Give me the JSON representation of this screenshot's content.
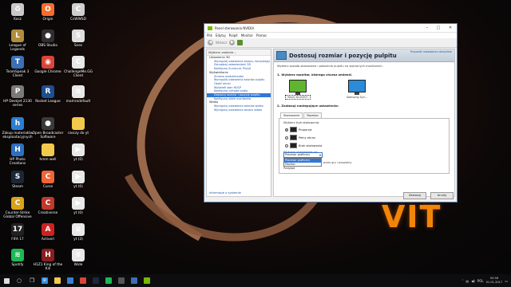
{
  "desktop": {
    "wallpaper_text": "VIT",
    "icons": [
      {
        "label": "Kosz",
        "icon": "recycle-bin-icon",
        "color": "#c9c9c9",
        "glyph": "♻"
      },
      {
        "label": "League of Legends",
        "icon": "league-of-legends-icon",
        "color": "#b08d3c",
        "glyph": "L"
      },
      {
        "label": "TeamSpeak 3 Client",
        "icon": "teamspeak-icon",
        "color": "#3d6fb5",
        "glyph": "T"
      },
      {
        "label": "HP Deskjet 2130 series",
        "icon": "printer-icon",
        "color": "#7a7a7a",
        "glyph": "P"
      },
      {
        "label": "Zakup materiałów eksploatacyjnych",
        "icon": "hp-icon",
        "color": "#2a7fd1",
        "glyph": "h"
      },
      {
        "label": "HP Photo Creations",
        "icon": "hp-photo-icon",
        "color": "#2f6fc1",
        "glyph": "H"
      },
      {
        "label": "Steam",
        "icon": "steam-icon",
        "color": "#1b2838",
        "glyph": "S"
      },
      {
        "label": "Counter-Strike Global Offensive",
        "icon": "csgo-icon",
        "color": "#d8a21a",
        "glyph": "C"
      },
      {
        "label": "FIFA 17",
        "icon": "fifa-icon",
        "color": "#222222",
        "glyph": "17"
      },
      {
        "label": "Spotify",
        "icon": "spotify-icon",
        "color": "#1db954",
        "glyph": "≋"
      },
      {
        "label": "Origin",
        "icon": "origin-icon",
        "color": "#f56c2d",
        "glyph": "O"
      },
      {
        "label": "OBS Studio",
        "icon": "obs-icon",
        "color": "#302e31",
        "glyph": "●"
      },
      {
        "label": "Google Chrome",
        "icon": "chrome-icon",
        "color": "#db4437",
        "glyph": "◉"
      },
      {
        "label": "Rocket League",
        "icon": "rocket-league-icon",
        "color": "#1d4f91",
        "glyph": "R"
      },
      {
        "label": "Open Broadcaster Software",
        "icon": "obs-classic-icon",
        "color": "#3a3a3a",
        "glyph": "●"
      },
      {
        "label": "hmm well",
        "icon": "folder-icon",
        "color": "#f2c94c",
        "glyph": ""
      },
      {
        "label": "Curse",
        "icon": "curse-icon",
        "color": "#f16436",
        "glyph": "C"
      },
      {
        "label": "Creativerse",
        "icon": "creativerse-icon",
        "color": "#c0392b",
        "glyph": "C"
      },
      {
        "label": "Activeri",
        "icon": "activeri-icon",
        "color": "#cc2222",
        "glyph": "A"
      },
      {
        "label": "H1Z1 King of the Kill",
        "icon": "h1z1-icon",
        "color": "#8a1f1f",
        "glyph": "H"
      },
      {
        "label": "CsWWSD",
        "icon": "app-icon",
        "color": "#cfcfcf",
        "glyph": "C"
      },
      {
        "label": "Snes",
        "icon": "snes-icon",
        "color": "#dddddd",
        "glyph": "S"
      },
      {
        "label": "ChallengeMe.GG Client",
        "icon": "challengeme-icon",
        "color": "#e8e8e8",
        "glyph": "C"
      },
      {
        "label": "mamrodefault",
        "icon": "file-icon",
        "color": "#e8e8e8",
        "glyph": "≡"
      },
      {
        "label": "rzeczy do yt",
        "icon": "folder-icon",
        "color": "#f2c94c",
        "glyph": ""
      },
      {
        "label": "yt (0)",
        "icon": "video-file-icon",
        "color": "#e8e8e8",
        "glyph": "▶"
      },
      {
        "label": "yt (0)",
        "icon": "video-file-icon",
        "color": "#e8e8e8",
        "glyph": "▶"
      },
      {
        "label": "yt (0)",
        "icon": "video-file-icon",
        "color": "#e8e8e8",
        "glyph": "▶"
      },
      {
        "label": "yt (3)",
        "icon": "document-icon",
        "color": "#e8e8e8",
        "glyph": "≡"
      },
      {
        "label": "Wide",
        "icon": "file-icon",
        "color": "#e8e8e8",
        "glyph": "≡"
      }
    ]
  },
  "window": {
    "title": "Panel sterowania NVIDIA",
    "menu": [
      "Plik",
      "Edytuj",
      "Pulpit",
      "Monitor",
      "Pomoc"
    ],
    "back_label": "Wstecz",
    "left_panel": {
      "header": "Wybierz zadanie...",
      "tree": [
        {
          "category": "Ustawienia 3D",
          "items": [
            {
              "label": "Wyregulój ustawienia obrazu, korzystając",
              "selected": false
            },
            {
              "label": "Zarządzaj ustawieniami 3D",
              "selected": false
            },
            {
              "label": "Konfiguruj Surround, PhysX",
              "selected": false
            }
          ]
        },
        {
          "category": "Wyświetlanie",
          "items": [
            {
              "label": "Zmiana rozdzielczości",
              "selected": false
            },
            {
              "label": "Wyregulój ustawienia kolorów pulpitu",
              "selected": false
            },
            {
              "label": "Obróć ekran",
              "selected": false
            },
            {
              "label": "Wyświetl stan HDCP",
              "selected": false
            },
            {
              "label": "Konfiguruj cyfrowe audio",
              "selected": false
            },
            {
              "label": "Dostosuj rozmiar i pozycję pulpitu",
              "selected": true
            },
            {
              "label": "Konfiguruj wiele monitorów",
              "selected": false
            }
          ]
        },
        {
          "category": "Wideo",
          "items": [
            {
              "label": "Wyreguluj ustawienia kolorów wideo",
              "selected": false
            },
            {
              "label": "Wyreguluj ustawienia obrazu wideo",
              "selected": false
            }
          ]
        }
      ],
      "system_info": "Informacje o systemie"
    },
    "content": {
      "title": "Dostosuj rozmiar i pozycję pulpitu",
      "restore_defaults": "Przywróć ustawienia domyślne",
      "subtitle": "Wybierz sposób skalowania i położenia pulpitu na wybranych monitorach.",
      "step1": "1. Wybierz monitor, którego chcesz zmienić.",
      "monitors": [
        {
          "label": "BenQ XL2430T",
          "selected": true
        },
        {
          "label": "Samsung Syn...",
          "selected": false
        }
      ],
      "step2": "2. Zastosuj następujące ustawienia:",
      "tabs": [
        "Skalowanie",
        "Rozmiar"
      ],
      "mode_label": "Wybierz tryb skalowania:",
      "modes": [
        {
          "label": "Proporcje",
          "checked": true
        },
        {
          "label": "Pełny ekran",
          "checked": false
        },
        {
          "label": "Brak skalowania",
          "checked": false
        }
      ],
      "perform_label": "Wykonaj skalowanie na:",
      "dropdown_value": "Procesor graficzny",
      "dropdown_options": [
        {
          "label": "Procesor graficzny",
          "highlighted": true
        },
        {
          "label": "Monitor",
          "highlighted": false
        }
      ],
      "extra_text": "przez gry i programy",
      "below_text": "Podgląd"
    },
    "buttons": {
      "apply": "Zastosuj",
      "cancel": "Anuluj"
    }
  },
  "taskbar": {
    "apps": [
      {
        "icon": "search-icon",
        "glyph": "○",
        "color": ""
      },
      {
        "icon": "task-view-icon",
        "glyph": "❐",
        "color": ""
      },
      {
        "icon": "edge-icon",
        "glyph": "e",
        "color": "#2f8fe0"
      },
      {
        "icon": "file-explorer-icon",
        "glyph": "",
        "color": "#f2c94c"
      },
      {
        "icon": "store-icon",
        "glyph": "",
        "color": "#3c7fd0"
      },
      {
        "icon": "chrome-icon",
        "glyph": "",
        "color": "#db4437"
      },
      {
        "icon": "steam-icon",
        "glyph": "",
        "color": "#1b2838"
      },
      {
        "icon": "spotify-icon",
        "glyph": "",
        "color": "#1db954"
      },
      {
        "icon": "obs-icon",
        "glyph": "",
        "color": "#555555"
      },
      {
        "icon": "teamspeak-icon",
        "glyph": "",
        "color": "#3d6fb5"
      },
      {
        "icon": "nvidia-icon",
        "glyph": "",
        "color": "#76b900"
      }
    ],
    "language": "POL",
    "time": "05:56",
    "date": "01.01.2017"
  }
}
